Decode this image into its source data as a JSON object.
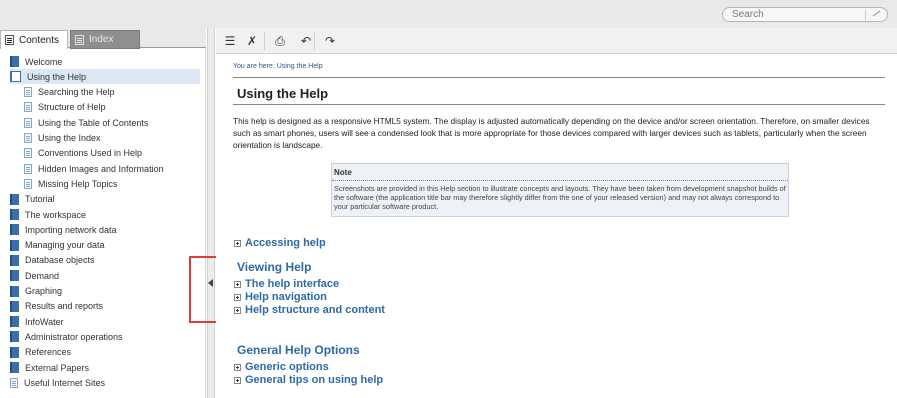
{
  "search": {
    "placeholder": "Search"
  },
  "tabs": [
    {
      "label": "Contents",
      "icon": "contents-icon",
      "active": true
    },
    {
      "label": "Index",
      "icon": "index-icon",
      "active": false
    }
  ],
  "toc": [
    {
      "label": "Welcome",
      "icon": "book-icon",
      "level": 0
    },
    {
      "label": "Using the Help",
      "icon": "book-open-icon",
      "level": 0,
      "selected": true
    },
    {
      "label": "Searching the Help",
      "icon": "page-icon",
      "level": 1
    },
    {
      "label": "Structure of Help",
      "icon": "page-icon",
      "level": 1
    },
    {
      "label": "Using the Table of Contents",
      "icon": "page-icon",
      "level": 1
    },
    {
      "label": "Using the Index",
      "icon": "page-icon",
      "level": 1
    },
    {
      "label": "Conventions Used in Help",
      "icon": "page-icon",
      "level": 1
    },
    {
      "label": "Hidden Images and Information",
      "icon": "page-icon",
      "level": 1
    },
    {
      "label": "Missing Help Topics",
      "icon": "page-icon",
      "level": 1
    },
    {
      "label": "Tutorial",
      "icon": "book-icon",
      "level": 0
    },
    {
      "label": "The workspace",
      "icon": "book-icon",
      "level": 0
    },
    {
      "label": "Importing network data",
      "icon": "book-icon",
      "level": 0
    },
    {
      "label": "Managing your data",
      "icon": "book-icon",
      "level": 0
    },
    {
      "label": "Database objects",
      "icon": "book-icon",
      "level": 0
    },
    {
      "label": "Demand",
      "icon": "book-icon",
      "level": 0
    },
    {
      "label": "Graphing",
      "icon": "book-icon",
      "level": 0
    },
    {
      "label": "Results and reports",
      "icon": "book-icon",
      "level": 0
    },
    {
      "label": "InfoWater",
      "icon": "book-icon",
      "level": 0
    },
    {
      "label": "Administrator operations",
      "icon": "book-icon",
      "level": 0
    },
    {
      "label": "References",
      "icon": "book-icon",
      "level": 0
    },
    {
      "label": "External Papers",
      "icon": "book-icon",
      "level": 0
    },
    {
      "label": "Useful Internet Sites",
      "icon": "page-icon",
      "level": 0
    }
  ],
  "toolbar": {
    "buttons": [
      {
        "name": "toc-toggle-button",
        "icon": "list-icon",
        "glyph": "☰"
      },
      {
        "name": "remove-highlight-button",
        "icon": "clear-highlight-icon",
        "glyph": "✗"
      },
      {
        "name": "print-button",
        "icon": "print-icon",
        "glyph": "⎙"
      },
      {
        "name": "back-button",
        "icon": "back-icon",
        "glyph": "↶"
      },
      {
        "name": "forward-button",
        "icon": "forward-icon",
        "glyph": "↷"
      }
    ]
  },
  "content": {
    "breadcrumb": "You are here: Using the Help",
    "title": "Using the Help",
    "intro": "This help is designed as a responsive HTML5 system. The display is adjusted automatically depending on the device and/or screen orientation. Therefore, on smaller devices such as smart phones, users will see a condensed look that is more appropriate for those devices compared with larger devices such as tablets, particularly when the screen orientation is landscape.",
    "note": {
      "label": "Note",
      "text": "Screenshots are provided in this Help section to illustrate concepts and layouts. They have been taken from development snapshot builds of the software (the application title bar may therefore slightly differ from the one of your released version) and may not always correspond to your particular software product."
    },
    "accessing_help": "Accessing help",
    "viewing_heading": "Viewing Help",
    "viewing_items": [
      "The help interface",
      "Help navigation",
      "Help structure and content"
    ],
    "general_heading": "General Help Options",
    "general_items": [
      "Generic options",
      "General tips on using help"
    ]
  },
  "colors": {
    "link": "#2e6aa6",
    "highlight_box": "#e03a3a",
    "selected_row": "#dce7f3"
  }
}
